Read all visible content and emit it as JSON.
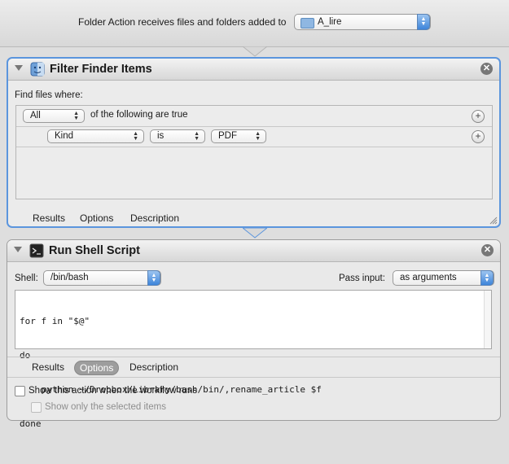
{
  "header": {
    "label": "Folder Action receives files and folders added to",
    "folder_value": "A_lire"
  },
  "filter_action": {
    "title": "Filter Finder Items",
    "find_label": "Find files where:",
    "match_value": "All",
    "match_suffix": "of the following are true",
    "criteria": {
      "attribute": "Kind",
      "operator": "is",
      "value": "PDF"
    },
    "tabs": [
      "Results",
      "Options",
      "Description"
    ]
  },
  "shell_action": {
    "title": "Run Shell Script",
    "shell_label": "Shell:",
    "shell_value": "/bin/bash",
    "pass_label": "Pass input:",
    "pass_value": "as arguments",
    "script_lines": [
      "for f in \"$@\"",
      "do",
      "    python ~/Dropbox/Library/bash/bin/,rename_article $f",
      "done"
    ],
    "tabs": [
      "Results",
      "Options",
      "Description"
    ],
    "active_tab": "Options",
    "show_action_label": "Show this action when the workflow runs",
    "show_selected_label": "Show only the selected items"
  }
}
